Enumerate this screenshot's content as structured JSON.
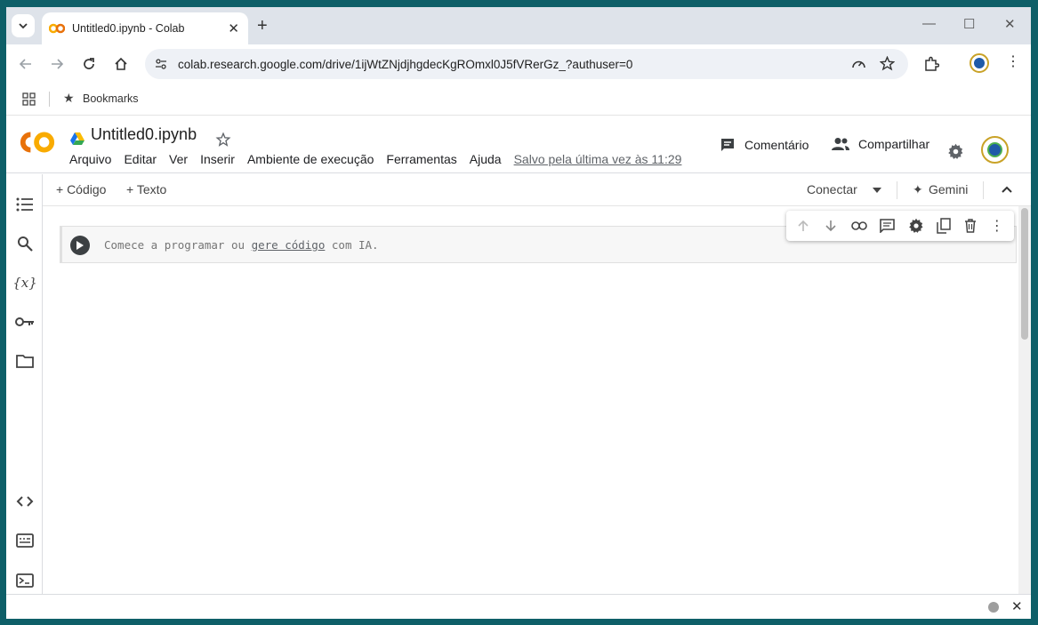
{
  "browser": {
    "tab_title": "Untitled0.ipynb - Colab",
    "url": "colab.research.google.com/drive/1ijWtZNjdjhgdecKgROmxl0J5fVRerGz_?authuser=0",
    "bookmarks_label": "Bookmarks"
  },
  "colab": {
    "logo_text": "CO",
    "notebook_title": "Untitled0.ipynb",
    "menu": [
      "Arquivo",
      "Editar",
      "Ver",
      "Inserir",
      "Ambiente de execução",
      "Ferramentas",
      "Ajuda"
    ],
    "saved_status": "Salvo pela última vez às 11:29",
    "comment_label": "Comentário",
    "share_label": "Compartilhar"
  },
  "toolbar": {
    "add_code": "+ Código",
    "add_text": "+ Texto",
    "connect": "Conectar",
    "gemini": "Gemini"
  },
  "cell": {
    "placeholder_start": "Comece a programar ou",
    "placeholder_link": "gere código",
    "placeholder_end": "com IA."
  },
  "sidebar_icons": [
    "toc-icon",
    "search-icon",
    "variables-icon",
    "key-icon",
    "folder-icon",
    "code-snippets-icon",
    "command-palette-icon",
    "terminal-icon"
  ],
  "colors": {
    "colab_orange": "#f9ab00",
    "colab_dark_orange": "#e8710a",
    "accent": "#1a73e8"
  }
}
